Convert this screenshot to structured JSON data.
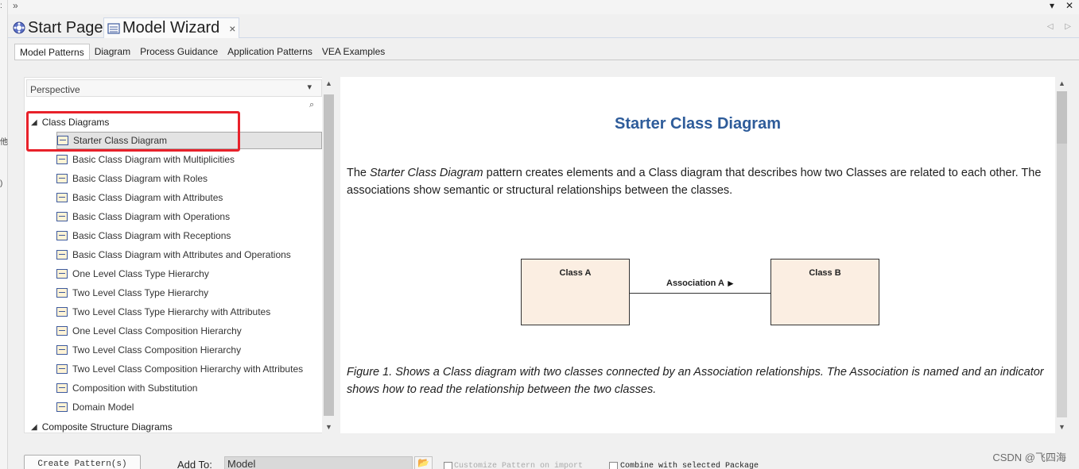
{
  "top_controls": {
    "overflow": "»",
    "dropdown": "▾",
    "close": "✕"
  },
  "left_strip_glyphs": [
    ":",
    "他",
    ")"
  ],
  "doc_tabs": [
    {
      "label": "Start Page",
      "icon": "start-page-icon"
    },
    {
      "label": "Model Wizard",
      "icon": "model-wizard-icon",
      "close": "×"
    }
  ],
  "doc_nav": "◁ ▷",
  "sub_tabs": [
    "Model Patterns",
    "Diagram",
    "Process Guidance",
    "Application Patterns",
    "VEA Examples"
  ],
  "perspective": {
    "label": "Perspective",
    "arrow": "▾"
  },
  "tree": {
    "group1": "Class Diagrams",
    "items": [
      "Starter Class Diagram",
      "Basic Class Diagram with Multiplicities",
      "Basic Class Diagram with Roles",
      "Basic Class Diagram with Attributes",
      "Basic Class Diagram with Operations",
      "Basic Class Diagram with Receptions",
      "Basic Class Diagram with Attributes and Operations",
      "One Level Class Type Hierarchy",
      "Two Level Class Type Hierarchy",
      "Two Level Class Type Hierarchy with Attributes",
      "One Level Class Composition Hierarchy",
      "Two Level Class Composition Hierarchy",
      "Two Level Class Composition Hierarchy with Attributes",
      "Composition with Substitution",
      "Domain Model"
    ],
    "selected_index": 0,
    "group2": "Composite Structure Diagrams"
  },
  "content": {
    "title": "Starter Class Diagram",
    "para1_pre": "The ",
    "para1_em": "Starter Class Diagram",
    "para1_post": " pattern creates elements and a Class diagram that describes how two Classes are related to each other. The associations show semantic or structural relationships between the classes.",
    "class_a": "Class A",
    "class_b": "Class B",
    "association": "Association A",
    "figure_caption": "Figure 1. Shows a Class diagram with two classes connected by an Association relationships. The Association is named and an indicator shows how to read the relationship between the two classes."
  },
  "bottom": {
    "create_button": "Create Pattern(s)",
    "add_to_label": "Add To:",
    "add_to_value": "Model",
    "customize_label": "Customize Pattern on import",
    "combine_label": "Combine with selected Package"
  },
  "watermark": "CSDN @飞四海",
  "colors": {
    "accent_title": "#2e5c9a",
    "highlight": "#e8212a",
    "class_fill": "#fbeee2"
  }
}
